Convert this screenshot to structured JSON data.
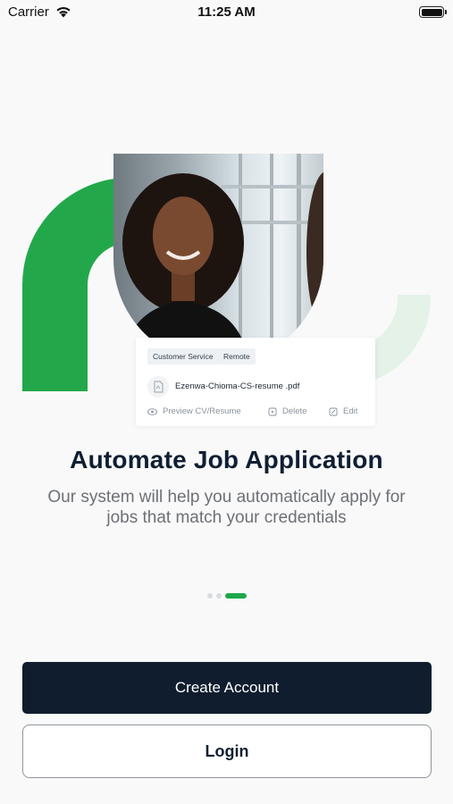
{
  "status_bar": {
    "carrier": "Carrier",
    "time": "11:25 AM"
  },
  "hero": {
    "tags": [
      "Customer Service",
      "Remote"
    ],
    "file_name": "Ezenwa-Chioma-CS-resume .pdf",
    "actions": {
      "preview": "Preview CV/Resume",
      "delete": "Delete",
      "edit": "Edit"
    },
    "accent_color": "#1ea84a"
  },
  "onboarding": {
    "title": "Automate Job Application",
    "subtitle": "Our system will help you automatically apply for jobs that match your credentials",
    "page_count": 3,
    "active_page": 3
  },
  "buttons": {
    "create_account": "Create Account",
    "login": "Login"
  }
}
